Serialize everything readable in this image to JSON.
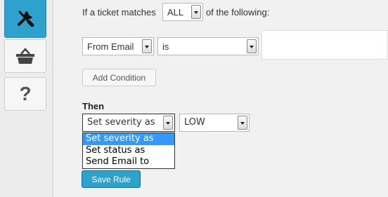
{
  "sidebar": {
    "items": [
      {
        "icon": "tools-icon",
        "active": true
      },
      {
        "icon": "basket-icon",
        "active": false
      },
      {
        "icon": "question-icon",
        "active": false
      }
    ],
    "help_glyph": "?"
  },
  "rule": {
    "match_prefix": "If a ticket matches",
    "match_value": "ALL",
    "match_suffix": "of the following:",
    "condition": {
      "field": "From Email",
      "operator": "is",
      "value": ""
    },
    "add_condition_label": "Add Condition",
    "then_label": "Then",
    "action": {
      "selected": "Set severity as",
      "options": [
        "Set severity as",
        "Set status as",
        "Send Email to"
      ],
      "highlighted": "Set severity as",
      "value": "LOW"
    },
    "save_label": "Save Rule"
  },
  "colors": {
    "accent": "#2ea2cc",
    "highlight": "#3399ff",
    "background": "#f1f1f1"
  }
}
